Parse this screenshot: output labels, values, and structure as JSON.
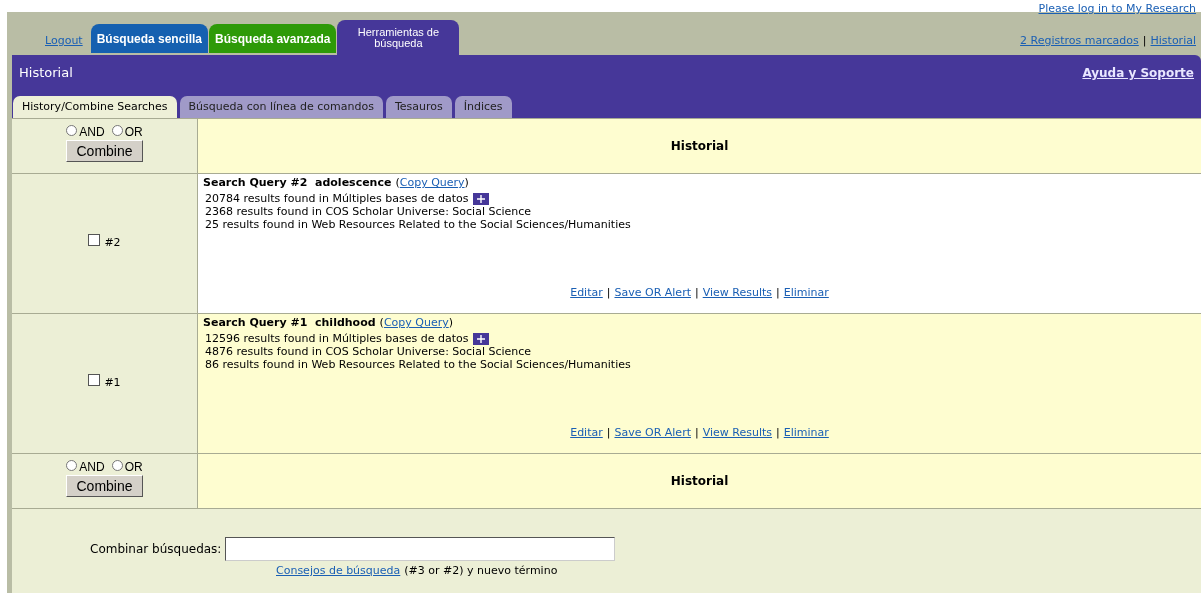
{
  "top_bar": {
    "login_link": "Please log in to My Research",
    "logout": "Logout",
    "tabs": [
      {
        "label": "Búsqueda sencilla",
        "color": "#1560b0",
        "selected": false
      },
      {
        "label": "Búsqueda avanzada",
        "color": "#2e9a08",
        "selected": false
      },
      {
        "label": "Herramientas de búsqueda",
        "color": "#463799",
        "selected": true
      }
    ],
    "marked_link": "2 Registros marcados",
    "separator": "|",
    "history_link": "Historial"
  },
  "header": {
    "title": "Historial",
    "help_link": "Ayuda y Soporte"
  },
  "sub_tabs": [
    {
      "label": "History/Combine Searches",
      "selected": true
    },
    {
      "label": "Búsqueda con línea de comandos",
      "selected": false
    },
    {
      "label": "Tesauros",
      "selected": false
    },
    {
      "label": "Índices",
      "selected": false
    }
  ],
  "combine_rows": [
    {
      "and_label": "AND",
      "or_label": "OR",
      "and_selected": false,
      "or_selected": false,
      "button": "Combine",
      "heading": "Historial"
    },
    {
      "and_label": "AND",
      "or_label": "OR",
      "and_selected": false,
      "or_selected": false,
      "button": "Combine",
      "heading": "Historial"
    }
  ],
  "queries": [
    {
      "label": "#2",
      "checked": false,
      "title": "Search Query #2  adolescence",
      "paren_open": "(",
      "copy_link": "Copy Query",
      "paren_close": ")",
      "separator": "|",
      "results": [
        {
          "text": "20784 results found in Múltiples bases de datos",
          "expandable": true
        },
        {
          "text": "2368 results found in COS Scholar Universe: Social Science",
          "expandable": false
        },
        {
          "text": "25 results found in Web Resources Related to the Social Sciences/Humanities",
          "expandable": false
        }
      ],
      "actions": [
        "Editar",
        "Save OR Alert",
        "View Results",
        "Eliminar"
      ]
    },
    {
      "label": "#1",
      "checked": false,
      "title": "Search Query #1  childhood",
      "paren_open": "(",
      "copy_link": "Copy Query",
      "paren_close": ")",
      "separator": "|",
      "results": [
        {
          "text": "12596 results found in Múltiples bases de datos",
          "expandable": true
        },
        {
          "text": "4876 results found in COS Scholar Universe: Social Science",
          "expandable": false
        },
        {
          "text": "86 results found in Web Resources Related to the Social Sciences/Humanities",
          "expandable": false
        }
      ],
      "actions": [
        "Editar",
        "Save OR Alert",
        "View Results",
        "Eliminar"
      ]
    }
  ],
  "combine_form": {
    "label": "Combinar búsquedas:",
    "tips_link": "Consejos de búsqueda",
    "hint": "(#3 or #2) y nuevo término"
  }
}
